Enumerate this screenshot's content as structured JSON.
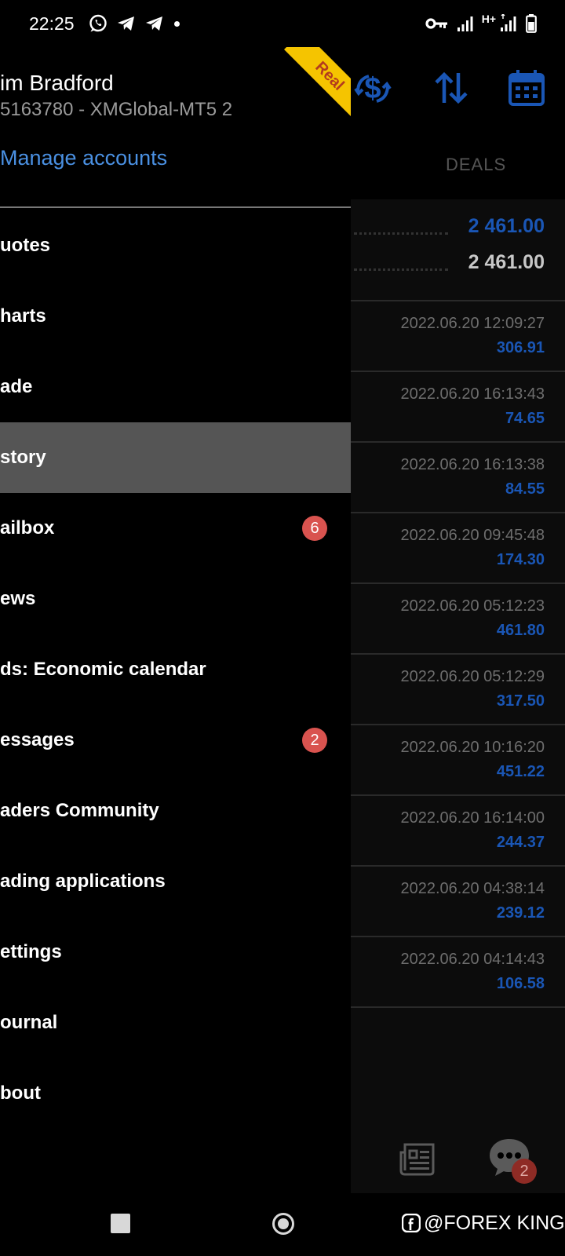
{
  "status_bar": {
    "time": "22:25",
    "network_label": "H+"
  },
  "header": {
    "account_name": "im Bradford",
    "account_login": "5163780 - XMGlobal-MT5 2",
    "manage_accounts": "Manage accounts",
    "ribbon_label": "Real"
  },
  "menu": {
    "items": [
      {
        "label": "uotes",
        "badge": ""
      },
      {
        "label": "harts",
        "badge": ""
      },
      {
        "label": "ade",
        "badge": ""
      },
      {
        "label": "story",
        "badge": ""
      },
      {
        "label": "ailbox",
        "badge": "6"
      },
      {
        "label": "ews",
        "badge": ""
      },
      {
        "label": "ds: Economic calendar",
        "badge": ""
      },
      {
        "label": "essages",
        "badge": "2"
      },
      {
        "label": "aders Community",
        "badge": ""
      },
      {
        "label": "ading applications",
        "badge": ""
      },
      {
        "label": "ettings",
        "badge": ""
      },
      {
        "label": "ournal",
        "badge": ""
      },
      {
        "label": "bout",
        "badge": ""
      }
    ],
    "active_index": 3
  },
  "deals_panel": {
    "tab_label": "DEALS",
    "summary": {
      "value_primary": "2 461.00",
      "value_secondary": "2 461.00"
    },
    "deals": [
      {
        "time": "2022.06.20 12:09:27",
        "amount": "306.91"
      },
      {
        "time": "2022.06.20 16:13:43",
        "amount": "74.65"
      },
      {
        "time": "2022.06.20 16:13:38",
        "amount": "84.55"
      },
      {
        "time": "2022.06.20 09:45:48",
        "amount": "174.30"
      },
      {
        "time": "2022.06.20 05:12:23",
        "amount": "461.80"
      },
      {
        "time": "2022.06.20 05:12:29",
        "amount": "317.50"
      },
      {
        "time": "2022.06.20 10:16:20",
        "amount": "451.22"
      },
      {
        "time": "2022.06.20 16:14:00",
        "amount": "244.37"
      },
      {
        "time": "2022.06.20 04:38:14",
        "amount": "239.12"
      },
      {
        "time": "2022.06.20 04:14:43",
        "amount": "106.58"
      }
    ],
    "chat_badge": "2"
  },
  "watermark": {
    "text": "@FOREX KING"
  },
  "colors": {
    "accent_blue": "#1a56b5",
    "link_blue": "#4a90e2",
    "badge_red": "#d9534f",
    "ribbon_yellow": "#f5c400",
    "active_item_bg": "#555555"
  },
  "icons": {
    "status_left": [
      "whatsapp-icon",
      "telegram-icon",
      "telegram-icon",
      "notification-dot-icon"
    ],
    "status_right": [
      "vpn-key-icon",
      "signal-icon",
      "signal-icon",
      "battery-icon"
    ],
    "toolbar": [
      "currency-exchange-icon",
      "sort-arrows-icon",
      "calendar-icon"
    ],
    "bottom": [
      "news-icon",
      "chat-icon"
    ],
    "nav": [
      "recent-apps-icon",
      "home-icon"
    ]
  }
}
